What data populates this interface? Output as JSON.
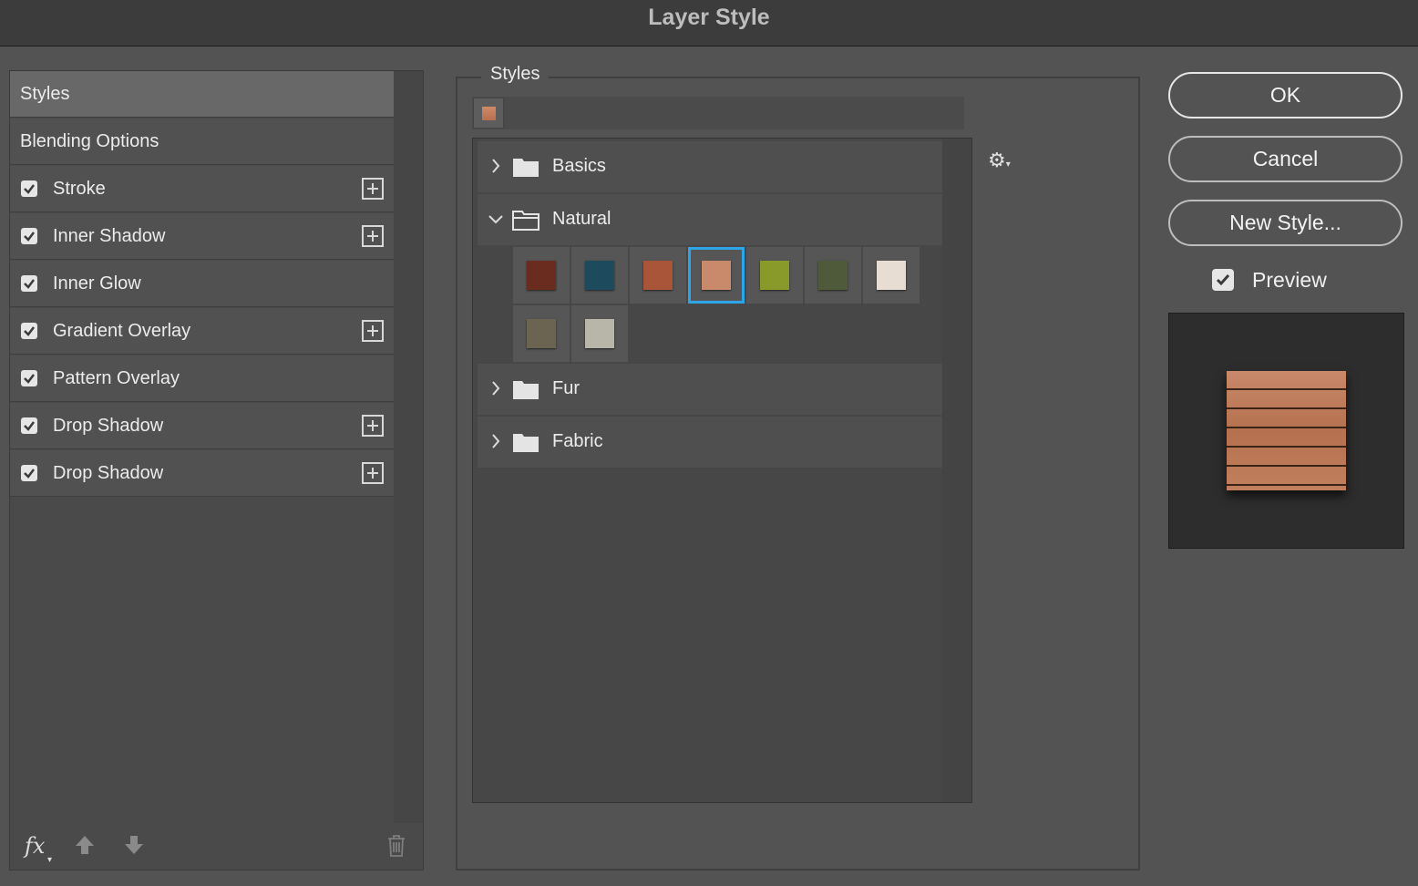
{
  "window": {
    "title": "Layer Style"
  },
  "left_panel": {
    "items": [
      {
        "label": "Styles",
        "checkbox": false,
        "plus": false,
        "active": true
      },
      {
        "label": "Blending Options",
        "checkbox": false,
        "plus": false,
        "active": false
      },
      {
        "label": "Stroke",
        "checkbox": true,
        "plus": true,
        "active": false
      },
      {
        "label": "Inner Shadow",
        "checkbox": true,
        "plus": true,
        "active": false
      },
      {
        "label": "Inner Glow",
        "checkbox": true,
        "plus": false,
        "active": false
      },
      {
        "label": "Gradient Overlay",
        "checkbox": true,
        "plus": true,
        "active": false
      },
      {
        "label": "Pattern Overlay",
        "checkbox": true,
        "plus": false,
        "active": false
      },
      {
        "label": "Drop Shadow",
        "checkbox": true,
        "plus": true,
        "active": false
      },
      {
        "label": "Drop Shadow",
        "checkbox": true,
        "plus": true,
        "active": false
      }
    ],
    "footer": {
      "fx_label": "fx",
      "fx_indicator": "▾",
      "icons": [
        "fx-icon",
        "move-up-icon",
        "move-down-icon",
        "trash-icon"
      ]
    }
  },
  "styles_group": {
    "label": "Styles",
    "folders": [
      {
        "name": "Basics",
        "expanded": false
      },
      {
        "name": "Natural",
        "expanded": true
      },
      {
        "name": "Fur",
        "expanded": false
      },
      {
        "name": "Fabric",
        "expanded": false
      }
    ],
    "natural_swatch_colors": [
      "#6a2c1e",
      "#1d4a5c",
      "#a8553a",
      "#c88a6a",
      "#8a9a2a",
      "#4e5a3a",
      "#e8ddd2",
      "#6b6450",
      "#b8b6a8"
    ],
    "selected_swatch_index": 3,
    "gear_icon": "gear-icon"
  },
  "buttons": {
    "ok": "OK",
    "cancel": "Cancel",
    "new_style": "New Style..."
  },
  "preview": {
    "label": "Preview",
    "checked": true
  },
  "colors": {
    "selection": "#2ea5e6",
    "wood": "#b87456"
  }
}
